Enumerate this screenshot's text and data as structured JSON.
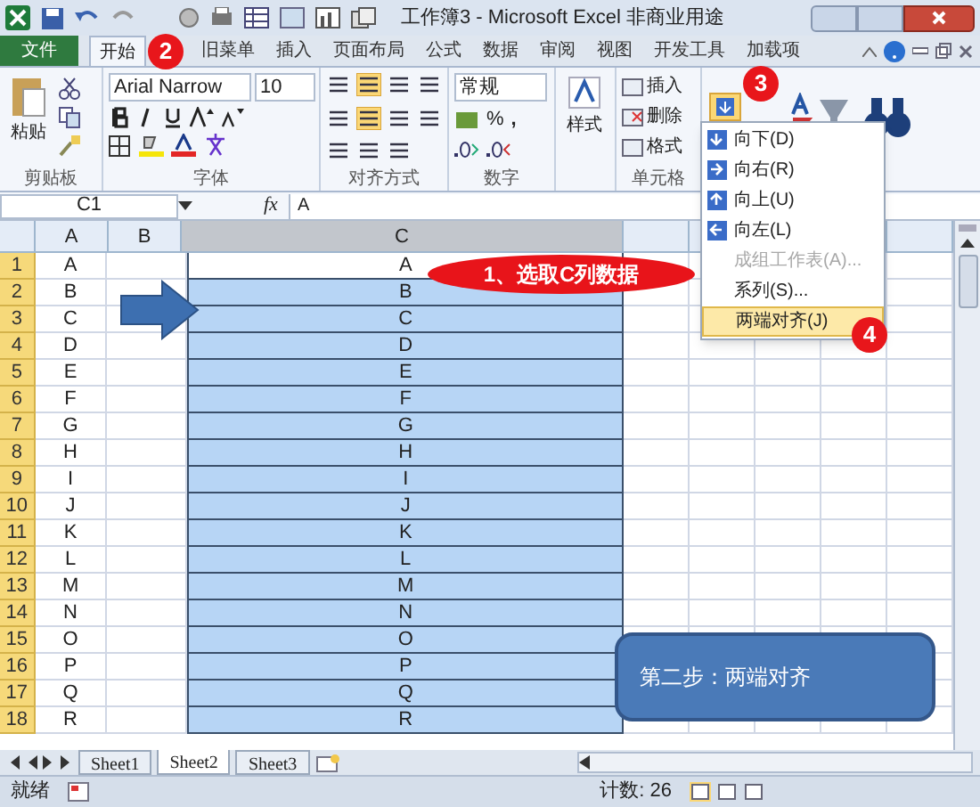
{
  "window": {
    "title": "工作簿3 - Microsoft Excel 非商业用途"
  },
  "ribbon_tabs": [
    {
      "label": "文件",
      "kind": "file",
      "selected": false
    },
    {
      "label": "开始",
      "kind": "tab",
      "selected": true
    },
    {
      "label": "旧菜单",
      "kind": "tab",
      "selected": false
    },
    {
      "label": "插入",
      "kind": "tab",
      "selected": false
    },
    {
      "label": "页面布局",
      "kind": "tab",
      "selected": false
    },
    {
      "label": "公式",
      "kind": "tab",
      "selected": false
    },
    {
      "label": "数据",
      "kind": "tab",
      "selected": false
    },
    {
      "label": "审阅",
      "kind": "tab",
      "selected": false
    },
    {
      "label": "视图",
      "kind": "tab",
      "selected": false
    },
    {
      "label": "开发工具",
      "kind": "tab",
      "selected": false
    },
    {
      "label": "加载项",
      "kind": "tab",
      "selected": false
    }
  ],
  "ribbon": {
    "paste": "粘贴",
    "font_name": "Arial Narrow",
    "font_size": "10",
    "number_format": "常规",
    "percent": "%",
    "comma": ",",
    "styles": "样式",
    "cell_commands": [
      "插入",
      "删除",
      "格式"
    ],
    "groups": [
      "剪贴板",
      "字体",
      "对齐方式",
      "数字",
      "单元格"
    ]
  },
  "fill_menu": [
    {
      "label": "向下(D)",
      "disabled": false,
      "selected": false,
      "icon": true
    },
    {
      "label": "向右(R)",
      "disabled": false,
      "selected": false,
      "icon": true
    },
    {
      "label": "向上(U)",
      "disabled": false,
      "selected": false,
      "icon": true
    },
    {
      "label": "向左(L)",
      "disabled": false,
      "selected": false,
      "icon": true
    },
    {
      "label": "成组工作表(A)...",
      "disabled": true,
      "selected": false,
      "icon": false
    },
    {
      "label": "系列(S)...",
      "disabled": false,
      "selected": false,
      "icon": false
    },
    {
      "label": "两端对齐(J)",
      "disabled": false,
      "selected": true,
      "icon": false
    }
  ],
  "formula_bar": {
    "name_box": "C1",
    "fx": "fx",
    "value": "A"
  },
  "sheet": {
    "columns": [
      "A",
      "B",
      "C"
    ],
    "rows": [
      {
        "number": "1",
        "a": "A",
        "c": "A",
        "selected": false
      },
      {
        "number": "2",
        "a": "B",
        "c": "B",
        "selected": true
      },
      {
        "number": "3",
        "a": "C",
        "c": "C",
        "selected": true
      },
      {
        "number": "4",
        "a": "D",
        "c": "D",
        "selected": true
      },
      {
        "number": "5",
        "a": "E",
        "c": "E",
        "selected": true
      },
      {
        "number": "6",
        "a": "F",
        "c": "F",
        "selected": true
      },
      {
        "number": "7",
        "a": "G",
        "c": "G",
        "selected": true
      },
      {
        "number": "8",
        "a": "H",
        "c": "H",
        "selected": true
      },
      {
        "number": "9",
        "a": "I",
        "c": "I",
        "selected": true
      },
      {
        "number": "10",
        "a": "J",
        "c": "J",
        "selected": true
      },
      {
        "number": "11",
        "a": "K",
        "c": "K",
        "selected": true
      },
      {
        "number": "12",
        "a": "L",
        "c": "L",
        "selected": true
      },
      {
        "number": "13",
        "a": "M",
        "c": "M",
        "selected": true
      },
      {
        "number": "14",
        "a": "N",
        "c": "N",
        "selected": true
      },
      {
        "number": "15",
        "a": "O",
        "c": "O",
        "selected": true
      },
      {
        "number": "16",
        "a": "P",
        "c": "P",
        "selected": true
      },
      {
        "number": "17",
        "a": "Q",
        "c": "Q",
        "selected": true
      },
      {
        "number": "18",
        "a": "R",
        "c": "R",
        "selected": true
      }
    ]
  },
  "sheet_tabs": [
    {
      "label": "Sheet1",
      "selected": false
    },
    {
      "label": "Sheet2",
      "selected": true
    },
    {
      "label": "Sheet3",
      "selected": false
    }
  ],
  "status_bar": {
    "state": "就绪",
    "count": "计数: 26"
  },
  "annotations": {
    "step_badges": [
      "2",
      "3",
      "4"
    ],
    "select_label": "1、选取C列数据",
    "callout": "第二步：两端对齐"
  }
}
